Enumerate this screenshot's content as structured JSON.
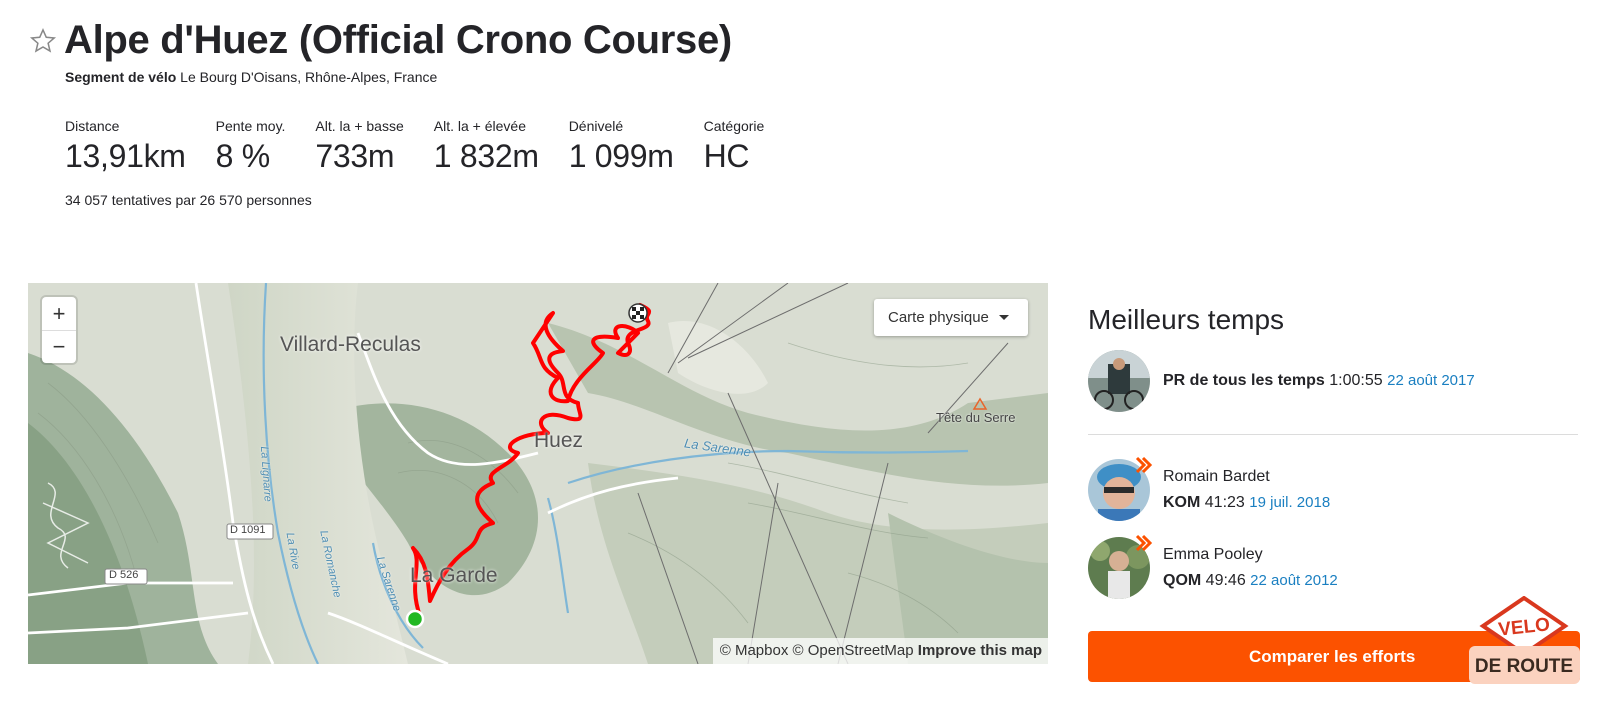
{
  "segment": {
    "title": "Alpe d'Huez (Official Crono Course)",
    "type_label": "Segment de vélo",
    "location": "Le Bourg D'Oisans, Rhône-Alpes, France"
  },
  "stats": [
    {
      "label": "Distance",
      "value": "13,91km"
    },
    {
      "label": "Pente moy.",
      "value": "8 %"
    },
    {
      "label": "Alt. la + basse",
      "value": "733m"
    },
    {
      "label": "Alt. la + élevée",
      "value": "1 832m"
    },
    {
      "label": "Dénivelé",
      "value": "1 099m"
    },
    {
      "label": "Catégorie",
      "value": "HC"
    }
  ],
  "attempts": "34 057 tentatives par 26 570 personnes",
  "map": {
    "zoom_in": "+",
    "zoom_out": "−",
    "layer": "Carte physique",
    "attribution_mapbox": "© Mapbox",
    "attribution_osm": "© OpenStreetMap",
    "attribution_improve": "Improve this map",
    "places": {
      "villard": "Villard-Reculas",
      "huez": "Huez",
      "lagarde": "La Garde",
      "serre": "Tête du Serre",
      "sarenne_river": "La Sarenne",
      "d1091": "D 1091",
      "d526": "D 526",
      "romanche": "La Romanche",
      "lignarre": "La Lignarre",
      "rive": "La Rive",
      "sarenne2": "La Sarenne"
    },
    "route_color": "#ff0000",
    "start_color": "#22b822"
  },
  "leaderboard": {
    "title": "Meilleurs temps",
    "pr": {
      "label": "PR de tous les temps",
      "time": "1:00:55",
      "date": "22 août 2017"
    },
    "kom": {
      "name": "Romain Bardet",
      "label": "KOM",
      "time": "41:23",
      "date": "19 juil. 2018"
    },
    "qom": {
      "name": "Emma Pooley",
      "label": "QOM",
      "time": "49:46",
      "date": "22 août 2012"
    }
  },
  "compare_button": "Comparer les efforts",
  "logo": {
    "line1": "VELO",
    "line2": "DE ROUTE"
  },
  "colors": {
    "accent": "#fc5200",
    "link": "#1a7fc1"
  }
}
